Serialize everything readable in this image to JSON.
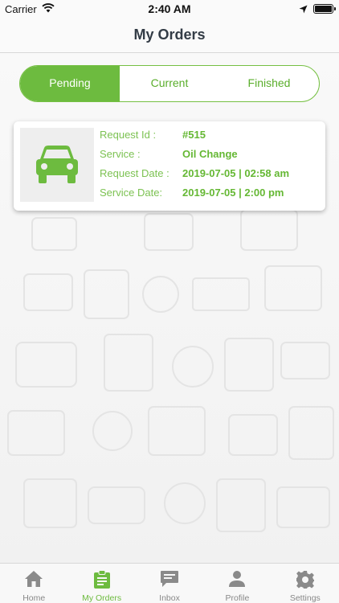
{
  "status_bar": {
    "carrier": "Carrier",
    "time": "2:40 AM"
  },
  "nav": {
    "title": "My Orders"
  },
  "segments": [
    {
      "label": "Pending",
      "active": true
    },
    {
      "label": "Current",
      "active": false
    },
    {
      "label": "Finished",
      "active": false
    }
  ],
  "order": {
    "thumbnail_icon": "car-icon",
    "request_id_label": "Request Id :",
    "request_id_value": "#515",
    "service_label": "Service :",
    "service_value": "Oil Change",
    "request_date_label": "Request Date :",
    "request_date_value": "2019-07-05 | 02:58 am",
    "service_date_label": "Service Date:",
    "service_date_value": "2019-07-05 | 2:00 pm"
  },
  "tabs": [
    {
      "label": "Home",
      "icon": "home-icon"
    },
    {
      "label": "My Orders",
      "icon": "clipboard-icon",
      "active": true
    },
    {
      "label": "Inbox",
      "icon": "chat-icon"
    },
    {
      "label": "Profile",
      "icon": "person-icon"
    },
    {
      "label": "Settings",
      "icon": "gear-icon"
    }
  ],
  "colors": {
    "accent": "#6dbb3f",
    "inactive": "#888888"
  }
}
